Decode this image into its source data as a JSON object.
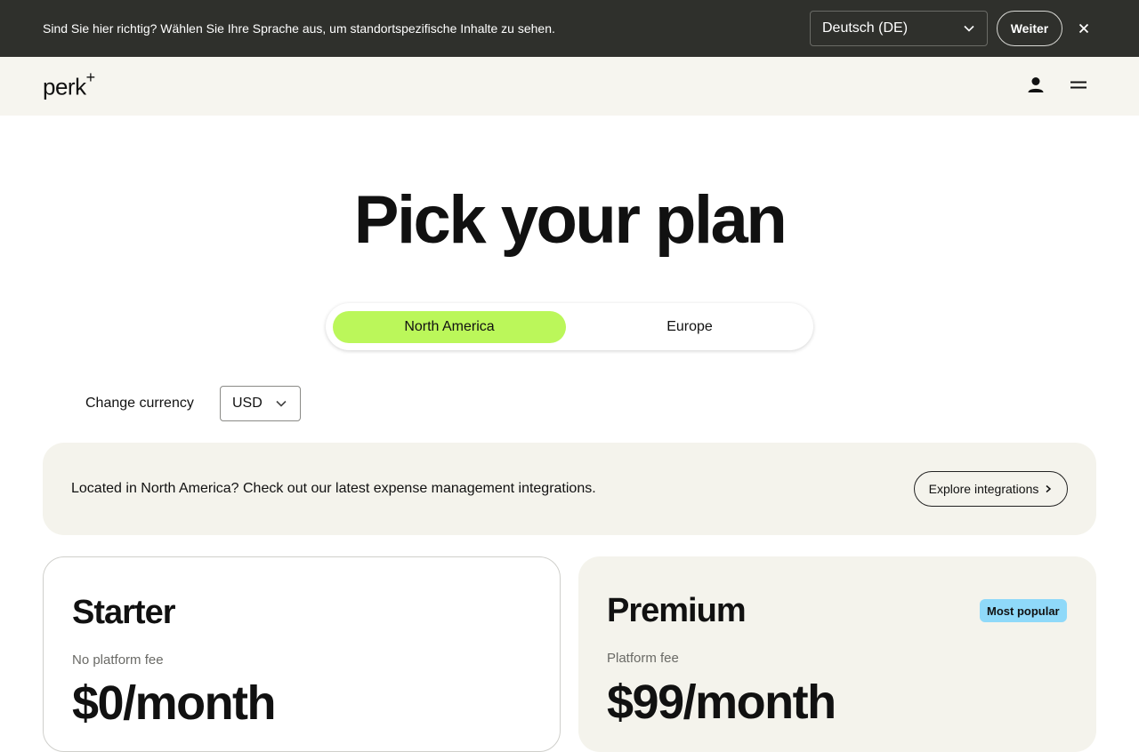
{
  "language_banner": {
    "message": "Sind Sie hier richtig? Wählen Sie Ihre Sprache aus, um standortspezifische Inhalte zu sehen.",
    "selected_language": "Deutsch (DE)",
    "continue_label": "Weiter"
  },
  "header": {
    "logo_text": "perk",
    "logo_mark": "+"
  },
  "page_title": "Pick your plan",
  "region_tabs": [
    {
      "label": "North America",
      "active": true
    },
    {
      "label": "Europe",
      "active": false
    }
  ],
  "currency": {
    "label": "Change currency",
    "selected": "USD"
  },
  "promo": {
    "text": "Located in North America? Check out our latest expense management integrations.",
    "button_label": "Explore integrations"
  },
  "plans": [
    {
      "name": "Starter",
      "fee_label": "No platform fee",
      "price": "$0/month"
    },
    {
      "name": "Premium",
      "badge": "Most popular",
      "fee_label": "Platform fee",
      "price": "$99/month"
    }
  ],
  "colors": {
    "banner_bg": "#2f302c",
    "header_bg": "#f6f5ef",
    "active_tab": "#bbf75a",
    "badge": "#8fd9f9",
    "card_bg": "#f4f3ec"
  }
}
